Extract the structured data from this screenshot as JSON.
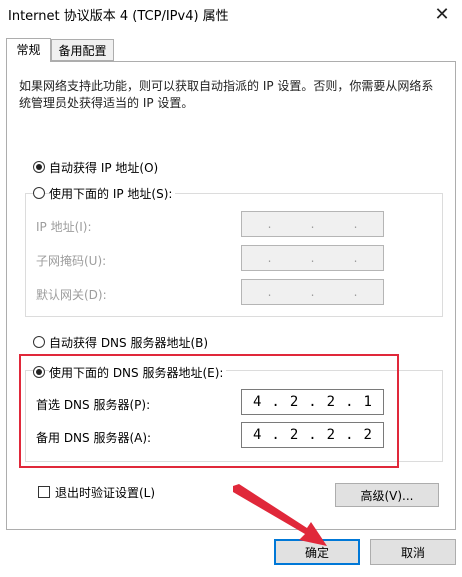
{
  "window": {
    "title": "Internet 协议版本 4 (TCP/IPv4) 属性",
    "close_glyph": "✕"
  },
  "tabs": [
    {
      "label": "常规",
      "active": true
    },
    {
      "label": "备用配置",
      "active": false
    }
  ],
  "description": "如果网络支持此功能，则可以获取自动指派的 IP 设置。否则，你需要从网络系统管理员处获得适当的 IP 设置。",
  "ip_mode": {
    "auto_label": "自动获得 IP 地址(O)",
    "manual_label": "使用下面的 IP 地址(S):",
    "auto_checked": true
  },
  "ip_fields": [
    {
      "label": "IP 地址(I):",
      "value": ""
    },
    {
      "label": "子网掩码(U):",
      "value": ""
    },
    {
      "label": "默认网关(D):",
      "value": ""
    }
  ],
  "dns_mode": {
    "auto_label": "自动获得 DNS 服务器地址(B)",
    "manual_label": "使用下面的 DNS 服务器地址(E):",
    "manual_checked": true
  },
  "dns_fields": [
    {
      "label": "首选 DNS 服务器(P):",
      "octets": [
        "4",
        "2",
        "2",
        "1"
      ]
    },
    {
      "label": "备用 DNS 服务器(A):",
      "octets": [
        "4",
        "2",
        "2",
        "2"
      ]
    }
  ],
  "validate_checkbox": {
    "label": "退出时验证设置(L)",
    "checked": false
  },
  "buttons": {
    "advanced": "高级(V)...",
    "ok": "确定",
    "cancel": "取消"
  },
  "colors": {
    "highlight_box": "#e0283a",
    "arrow": "#e0283a",
    "default_button_border": "#0078d7"
  }
}
